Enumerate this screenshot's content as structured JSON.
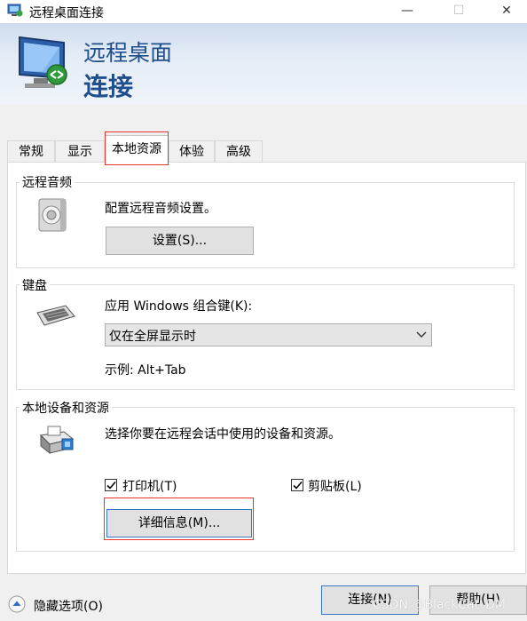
{
  "window": {
    "title": "远程桌面连接"
  },
  "banner": {
    "line1": "远程桌面",
    "line2": "连接"
  },
  "tabs": [
    {
      "label": "常规",
      "active": false
    },
    {
      "label": "显示",
      "active": false
    },
    {
      "label": "本地资源",
      "active": true
    },
    {
      "label": "体验",
      "active": false
    },
    {
      "label": "高级",
      "active": false
    }
  ],
  "audio": {
    "title": "远程音频",
    "description": "配置远程音频设置。",
    "settings_button": "设置(S)..."
  },
  "keyboard": {
    "title": "键盘",
    "label": "应用 Windows 组合键(K):",
    "selected_option": "仅在全屏显示时",
    "example": "示例: Alt+Tab"
  },
  "devices": {
    "title": "本地设备和资源",
    "description": "选择你要在远程会话中使用的设备和资源。",
    "printers_label": "打印机(T)",
    "printers_checked": true,
    "clipboard_label": "剪贴板(L)",
    "clipboard_checked": true,
    "details_button": "详细信息(M)..."
  },
  "footer": {
    "hide_options": "隐藏选项(O)",
    "connect_button": "连接(N)",
    "help_button": "帮助(H)",
    "watermark": "CSDN @BlackCat_DM"
  },
  "colors": {
    "accent_text": "#1f4e8c",
    "highlight_red": "#e8342a"
  }
}
